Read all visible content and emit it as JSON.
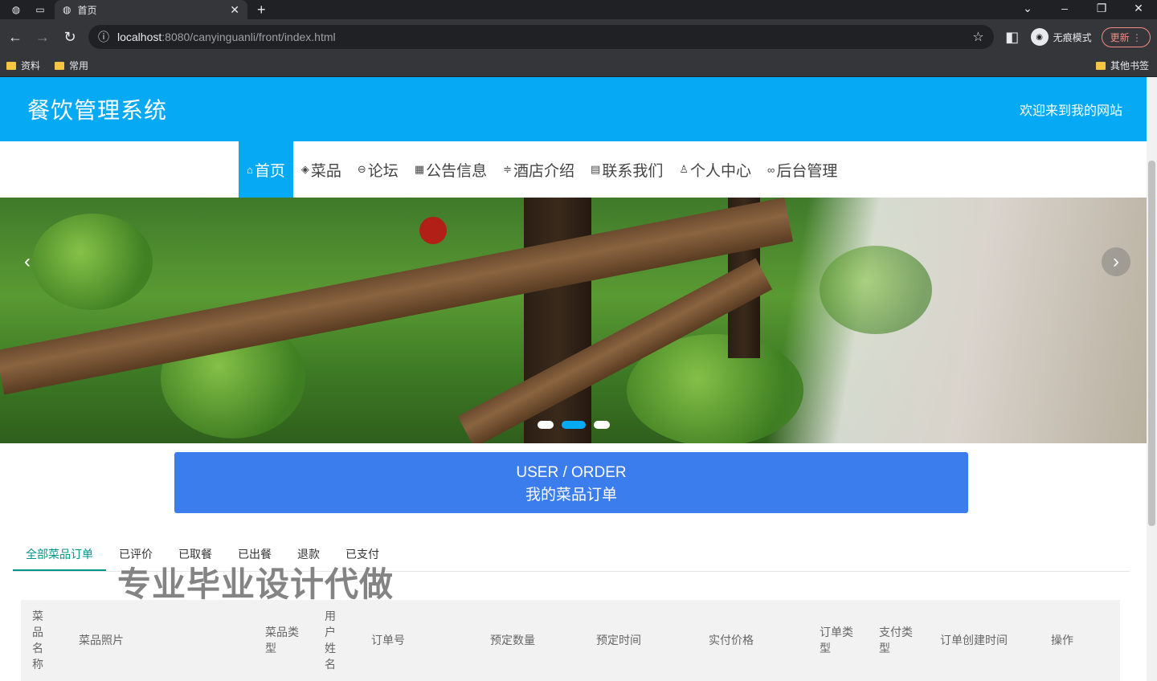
{
  "browser": {
    "tab_title": "首页",
    "url_host": "localhost",
    "url_path": ":8080/canyinguanli/front/index.html",
    "profile_label": "无痕模式",
    "update_label": "更新",
    "bookmarks": [
      "资料",
      "常用"
    ],
    "other_bookmarks": "其他书签"
  },
  "header": {
    "site_title": "餐饮管理系统",
    "welcome": "欢迎来到我的网站"
  },
  "menu": [
    {
      "icon": "⌂",
      "label": "首页",
      "icon_name": "home-icon"
    },
    {
      "icon": "◈",
      "label": "菜品",
      "icon_name": "layers-icon"
    },
    {
      "icon": "⊖",
      "label": "论坛",
      "icon_name": "forum-icon"
    },
    {
      "icon": "▦",
      "label": "公告信息",
      "icon_name": "grid-icon"
    },
    {
      "icon": "≑",
      "label": "酒店介绍",
      "icon_name": "sliders-icon"
    },
    {
      "icon": "▤",
      "label": "联系我们",
      "icon_name": "document-icon"
    },
    {
      "icon": "♙",
      "label": "个人中心",
      "icon_name": "user-icon"
    },
    {
      "icon": "∞",
      "label": "后台管理",
      "icon_name": "link-icon"
    }
  ],
  "carousel": {
    "prev": "‹",
    "next": "›",
    "dot_count": 3,
    "active_dot": 2
  },
  "order_banner": {
    "line1": "USER / ORDER",
    "line2": "我的菜品订单"
  },
  "tabs": [
    "全部菜品订单",
    "已评价",
    "已取餐",
    "已出餐",
    "退款",
    "已支付"
  ],
  "watermark": "专业毕业设计代做",
  "table": {
    "columns": [
      "菜品名称",
      "菜品照片",
      "菜品类型",
      "用户姓名",
      "订单号",
      "预定数量",
      "预定时间",
      "实付价格",
      "订单类型",
      "支付类型",
      "订单创建时间",
      "操作"
    ]
  },
  "colors": {
    "primary": "#06a9f3",
    "banner": "#3c7ded",
    "tab_active": "#009688"
  }
}
